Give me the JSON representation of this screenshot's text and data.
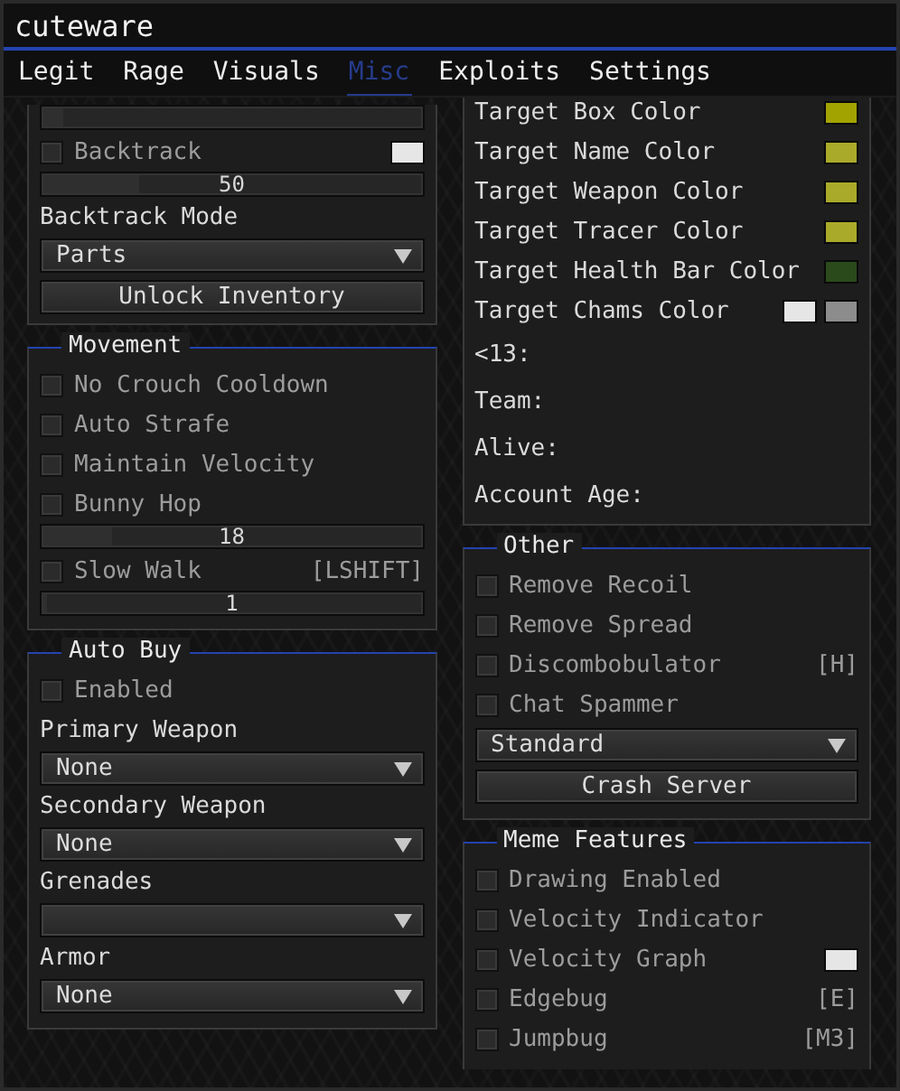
{
  "window": {
    "title": "cuteware"
  },
  "tabs": [
    {
      "label": "Legit",
      "selected": false
    },
    {
      "label": "Rage",
      "selected": false
    },
    {
      "label": "Visuals",
      "selected": false
    },
    {
      "label": "Misc",
      "selected": true
    },
    {
      "label": "Exploits",
      "selected": false
    },
    {
      "label": "Settings",
      "selected": false
    }
  ],
  "left_column": [
    {
      "items": [
        {
          "kind": "slider",
          "level": 0.05
        },
        {
          "kind": "checkbox",
          "label": "Backtrack",
          "checked": false,
          "swatches": [
            {
              "color": "#e6e6e6"
            }
          ]
        },
        {
          "kind": "slider",
          "value": "50",
          "level": 0.25
        },
        {
          "kind": "label",
          "label": "Backtrack Mode"
        },
        {
          "kind": "combo",
          "value": "Parts"
        },
        {
          "kind": "button",
          "label": "Unlock Inventory"
        }
      ]
    },
    {
      "title": "Movement",
      "items": [
        {
          "kind": "checkbox",
          "label": "No Crouch Cooldown",
          "checked": false
        },
        {
          "kind": "checkbox",
          "label": "Auto Strafe",
          "checked": false
        },
        {
          "kind": "checkbox",
          "label": "Maintain Velocity",
          "checked": false
        },
        {
          "kind": "checkbox",
          "label": "Bunny Hop",
          "checked": false
        },
        {
          "kind": "slider",
          "value": "18",
          "level": 0.18
        },
        {
          "kind": "checkbox",
          "label": "Slow Walk",
          "checked": false,
          "hotkey": "[LSHIFT]"
        },
        {
          "kind": "slider",
          "value": "1",
          "level": 0.01
        }
      ]
    },
    {
      "title": "Auto Buy",
      "items": [
        {
          "kind": "checkbox",
          "label": "Enabled",
          "checked": false
        },
        {
          "kind": "label",
          "label": "Primary Weapon"
        },
        {
          "kind": "combo",
          "value": "None"
        },
        {
          "kind": "label",
          "label": "Secondary Weapon"
        },
        {
          "kind": "combo",
          "value": "None"
        },
        {
          "kind": "label",
          "label": "Grenades"
        },
        {
          "kind": "combo"
        },
        {
          "kind": "label",
          "label": "Armor"
        },
        {
          "kind": "combo",
          "value": "None"
        }
      ]
    }
  ],
  "right_column": [
    {
      "items": [
        {
          "kind": "color",
          "label": "Target Box Color",
          "swatches": [
            {
              "color": "#a3a300"
            }
          ]
        },
        {
          "kind": "color",
          "label": "Target Name Color",
          "swatches": [
            {
              "color": "#aaaa2a"
            }
          ]
        },
        {
          "kind": "color",
          "label": "Target Weapon Color",
          "swatches": [
            {
              "color": "#aaaa2a"
            }
          ]
        },
        {
          "kind": "color",
          "label": "Target Tracer Color",
          "swatches": [
            {
              "color": "#aaaa2a"
            }
          ]
        },
        {
          "kind": "color",
          "label": "Target Health Bar Color",
          "swatches": [
            {
              "color": "#2b4a1b"
            }
          ]
        },
        {
          "kind": "color",
          "label": "Target Chams Color",
          "swatches": [
            {
              "color": "#e6e6e6"
            },
            {
              "color": "#8c8c8c"
            }
          ]
        },
        {
          "kind": "info",
          "label": "<13:"
        },
        {
          "kind": "info",
          "label": "Team:"
        },
        {
          "kind": "info",
          "label": "Alive:"
        },
        {
          "kind": "info",
          "label": "Account Age:"
        }
      ]
    },
    {
      "title": "Other",
      "items": [
        {
          "kind": "checkbox",
          "label": "Remove Recoil",
          "checked": false
        },
        {
          "kind": "checkbox",
          "label": "Remove Spread",
          "checked": false
        },
        {
          "kind": "checkbox",
          "label": "Discombobulator",
          "checked": false,
          "hotkey": "[H]"
        },
        {
          "kind": "checkbox",
          "label": "Chat Spammer",
          "checked": false
        },
        {
          "kind": "combo",
          "value": "Standard"
        },
        {
          "kind": "button",
          "label": "Crash Server"
        }
      ]
    },
    {
      "title": "Meme Features",
      "items": [
        {
          "kind": "checkbox",
          "label": "Drawing Enabled",
          "checked": false
        },
        {
          "kind": "checkbox",
          "label": "Velocity Indicator",
          "checked": false
        },
        {
          "kind": "checkbox",
          "label": "Velocity Graph",
          "checked": false,
          "swatches": [
            {
              "color": "#e6e6e6"
            }
          ]
        },
        {
          "kind": "checkbox",
          "label": "Edgebug",
          "checked": false,
          "hotkey": "[E]"
        },
        {
          "kind": "checkbox",
          "label": "Jumpbug",
          "checked": false,
          "hotkey": "[M3]"
        }
      ]
    }
  ]
}
